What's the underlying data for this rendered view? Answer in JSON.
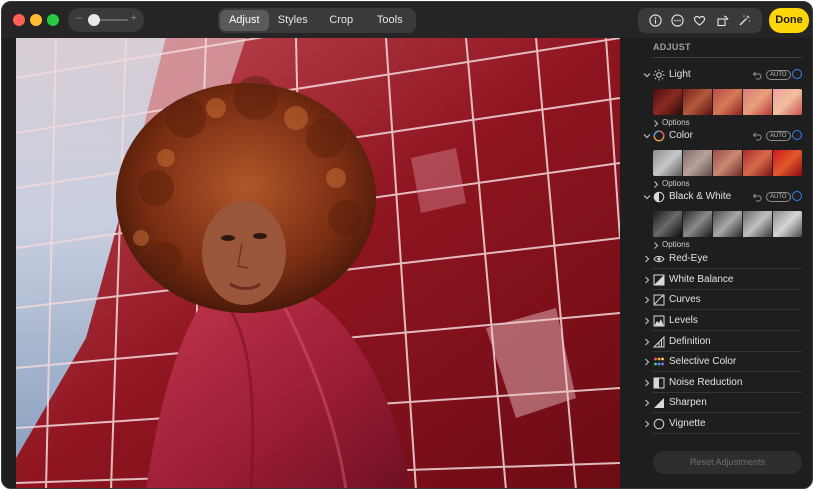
{
  "toolbar": {
    "zoom_minus": "–",
    "zoom_plus": "+",
    "zoom_level": 0.15,
    "tabs": [
      {
        "label": "Adjust",
        "active": true
      },
      {
        "label": "Styles",
        "active": false
      },
      {
        "label": "Crop",
        "active": false
      },
      {
        "label": "Tools",
        "active": false
      }
    ],
    "icons": [
      "info-icon",
      "more-icon",
      "heart-icon",
      "rotate-icon",
      "magic-wand-icon"
    ],
    "done_label": "Done",
    "accent": "#ffd60a"
  },
  "sidebar": {
    "title": "ADJUST",
    "auto_label": "AUTO",
    "options_label": "Options",
    "expanded_sections": [
      {
        "label": "Light",
        "icon": "sun-icon"
      },
      {
        "label": "Color",
        "icon": "color-circle-icon"
      },
      {
        "label": "Black & White",
        "icon": "half-circle-icon"
      }
    ],
    "collapsed_sections": [
      {
        "label": "Red-Eye",
        "icon": "eye-icon"
      },
      {
        "label": "White Balance",
        "icon": "white-balance-icon"
      },
      {
        "label": "Curves",
        "icon": "curves-icon"
      },
      {
        "label": "Levels",
        "icon": "levels-icon"
      },
      {
        "label": "Definition",
        "icon": "definition-icon"
      },
      {
        "label": "Selective Color",
        "icon": "selective-color-icon"
      },
      {
        "label": "Noise Reduction",
        "icon": "noise-reduction-icon"
      },
      {
        "label": "Sharpen",
        "icon": "sharpen-icon"
      },
      {
        "label": "Vignette",
        "icon": "vignette-icon"
      }
    ],
    "reset_label": "Reset Adjustments",
    "ring_color": "#2f84ff"
  }
}
